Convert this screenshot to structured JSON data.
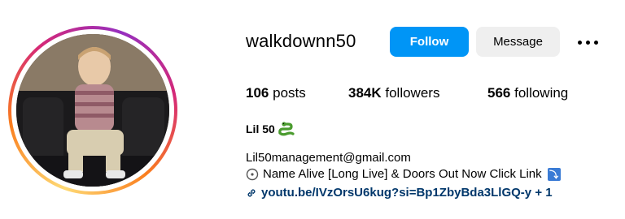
{
  "profile": {
    "username": "walkdownn50",
    "display_name": "Lil 50",
    "display_emoji": "snake",
    "follow_label": "Follow",
    "message_label": "Message",
    "more_icon": "more-horizontal-icon"
  },
  "stats": {
    "posts_count": "106",
    "posts_label": "posts",
    "followers_count": "384K",
    "followers_label": "followers",
    "following_count": "566",
    "following_label": "following"
  },
  "bio": {
    "line1": "Lil50management@gmail.com",
    "line2": "Name Alive [Long Live] & Doors Out Now Click Link",
    "link_text": "youtu.be/IVzOrsU6kug?si=Bp1ZbyBda3LlGQ-y + 1"
  },
  "colors": {
    "follow_button": "#0095f6",
    "message_button": "#efefef",
    "link": "#00376b"
  }
}
